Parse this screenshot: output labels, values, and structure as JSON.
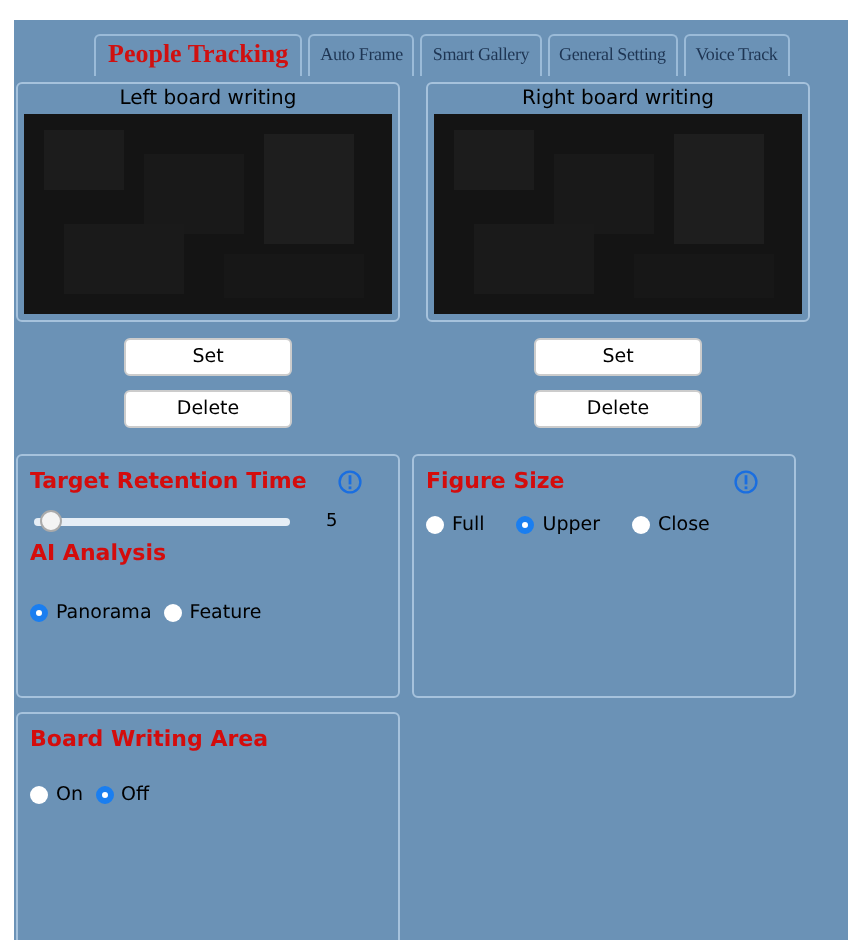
{
  "tabs": [
    {
      "label": "People Tracking",
      "selected": true
    },
    {
      "label": "Auto Frame",
      "selected": false
    },
    {
      "label": "Smart Gallery",
      "selected": false
    },
    {
      "label": "General Setting",
      "selected": false
    },
    {
      "label": "Voice Track",
      "selected": false
    }
  ],
  "boards": [
    {
      "title": "Left board writing",
      "buttons": [
        "Set",
        "Delete"
      ]
    },
    {
      "title": "Right board writing",
      "buttons": [
        "Set",
        "Delete"
      ]
    }
  ],
  "retention": {
    "title": "Target Retention Time",
    "level": 0.05,
    "reading": "5"
  },
  "ai_analysis": {
    "title": "AI Analysis",
    "options": [
      {
        "label": "Panorama",
        "selected": true
      },
      {
        "label": "Feature",
        "selected": false
      }
    ]
  },
  "figure_size": {
    "title": "Figure Size",
    "options": [
      {
        "label": "Full",
        "selected": false
      },
      {
        "label": "Upper",
        "selected": true
      },
      {
        "label": "Close",
        "selected": false
      }
    ]
  },
  "board_writing_area": {
    "title": "Board Writing Area",
    "options": [
      {
        "label": "On",
        "selected": false
      },
      {
        "label": "Off",
        "selected": true
      }
    ]
  }
}
